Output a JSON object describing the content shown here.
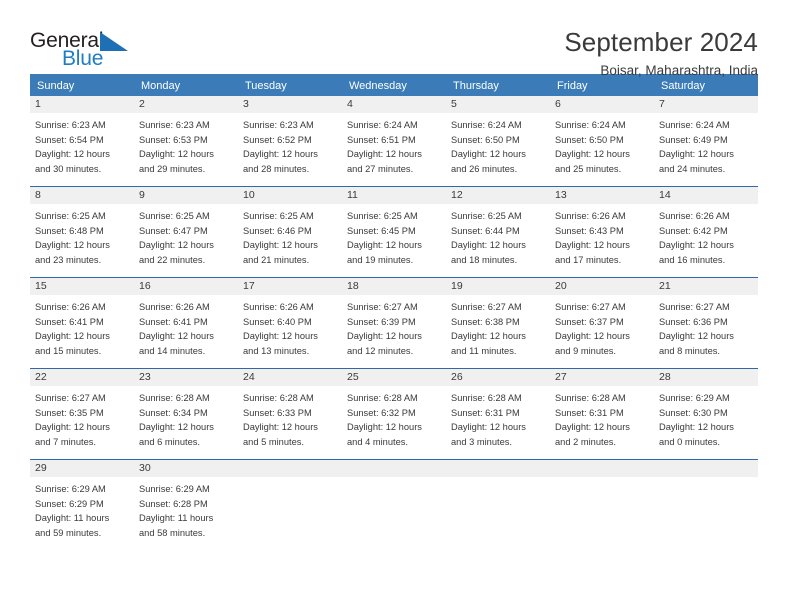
{
  "brand": {
    "name_part1": "General",
    "name_part2": "Blue",
    "logo_icon": "triangle-mark-icon",
    "accent_color": "#1f7dc4"
  },
  "header": {
    "title": "September 2024",
    "subtitle": "Boisar, Maharashtra, India"
  },
  "calendar": {
    "header_color": "#3b7cb8",
    "daynum_band_color": "#f0f0f0",
    "weekdays": [
      "Sunday",
      "Monday",
      "Tuesday",
      "Wednesday",
      "Thursday",
      "Friday",
      "Saturday"
    ],
    "weeks": [
      [
        {
          "day": "1",
          "sunrise": "Sunrise: 6:23 AM",
          "sunset": "Sunset: 6:54 PM",
          "daylight_line1": "Daylight: 12 hours",
          "daylight_line2": "and 30 minutes."
        },
        {
          "day": "2",
          "sunrise": "Sunrise: 6:23 AM",
          "sunset": "Sunset: 6:53 PM",
          "daylight_line1": "Daylight: 12 hours",
          "daylight_line2": "and 29 minutes."
        },
        {
          "day": "3",
          "sunrise": "Sunrise: 6:23 AM",
          "sunset": "Sunset: 6:52 PM",
          "daylight_line1": "Daylight: 12 hours",
          "daylight_line2": "and 28 minutes."
        },
        {
          "day": "4",
          "sunrise": "Sunrise: 6:24 AM",
          "sunset": "Sunset: 6:51 PM",
          "daylight_line1": "Daylight: 12 hours",
          "daylight_line2": "and 27 minutes."
        },
        {
          "day": "5",
          "sunrise": "Sunrise: 6:24 AM",
          "sunset": "Sunset: 6:50 PM",
          "daylight_line1": "Daylight: 12 hours",
          "daylight_line2": "and 26 minutes."
        },
        {
          "day": "6",
          "sunrise": "Sunrise: 6:24 AM",
          "sunset": "Sunset: 6:50 PM",
          "daylight_line1": "Daylight: 12 hours",
          "daylight_line2": "and 25 minutes."
        },
        {
          "day": "7",
          "sunrise": "Sunrise: 6:24 AM",
          "sunset": "Sunset: 6:49 PM",
          "daylight_line1": "Daylight: 12 hours",
          "daylight_line2": "and 24 minutes."
        }
      ],
      [
        {
          "day": "8",
          "sunrise": "Sunrise: 6:25 AM",
          "sunset": "Sunset: 6:48 PM",
          "daylight_line1": "Daylight: 12 hours",
          "daylight_line2": "and 23 minutes."
        },
        {
          "day": "9",
          "sunrise": "Sunrise: 6:25 AM",
          "sunset": "Sunset: 6:47 PM",
          "daylight_line1": "Daylight: 12 hours",
          "daylight_line2": "and 22 minutes."
        },
        {
          "day": "10",
          "sunrise": "Sunrise: 6:25 AM",
          "sunset": "Sunset: 6:46 PM",
          "daylight_line1": "Daylight: 12 hours",
          "daylight_line2": "and 21 minutes."
        },
        {
          "day": "11",
          "sunrise": "Sunrise: 6:25 AM",
          "sunset": "Sunset: 6:45 PM",
          "daylight_line1": "Daylight: 12 hours",
          "daylight_line2": "and 19 minutes."
        },
        {
          "day": "12",
          "sunrise": "Sunrise: 6:25 AM",
          "sunset": "Sunset: 6:44 PM",
          "daylight_line1": "Daylight: 12 hours",
          "daylight_line2": "and 18 minutes."
        },
        {
          "day": "13",
          "sunrise": "Sunrise: 6:26 AM",
          "sunset": "Sunset: 6:43 PM",
          "daylight_line1": "Daylight: 12 hours",
          "daylight_line2": "and 17 minutes."
        },
        {
          "day": "14",
          "sunrise": "Sunrise: 6:26 AM",
          "sunset": "Sunset: 6:42 PM",
          "daylight_line1": "Daylight: 12 hours",
          "daylight_line2": "and 16 minutes."
        }
      ],
      [
        {
          "day": "15",
          "sunrise": "Sunrise: 6:26 AM",
          "sunset": "Sunset: 6:41 PM",
          "daylight_line1": "Daylight: 12 hours",
          "daylight_line2": "and 15 minutes."
        },
        {
          "day": "16",
          "sunrise": "Sunrise: 6:26 AM",
          "sunset": "Sunset: 6:41 PM",
          "daylight_line1": "Daylight: 12 hours",
          "daylight_line2": "and 14 minutes."
        },
        {
          "day": "17",
          "sunrise": "Sunrise: 6:26 AM",
          "sunset": "Sunset: 6:40 PM",
          "daylight_line1": "Daylight: 12 hours",
          "daylight_line2": "and 13 minutes."
        },
        {
          "day": "18",
          "sunrise": "Sunrise: 6:27 AM",
          "sunset": "Sunset: 6:39 PM",
          "daylight_line1": "Daylight: 12 hours",
          "daylight_line2": "and 12 minutes."
        },
        {
          "day": "19",
          "sunrise": "Sunrise: 6:27 AM",
          "sunset": "Sunset: 6:38 PM",
          "daylight_line1": "Daylight: 12 hours",
          "daylight_line2": "and 11 minutes."
        },
        {
          "day": "20",
          "sunrise": "Sunrise: 6:27 AM",
          "sunset": "Sunset: 6:37 PM",
          "daylight_line1": "Daylight: 12 hours",
          "daylight_line2": "and 9 minutes."
        },
        {
          "day": "21",
          "sunrise": "Sunrise: 6:27 AM",
          "sunset": "Sunset: 6:36 PM",
          "daylight_line1": "Daylight: 12 hours",
          "daylight_line2": "and 8 minutes."
        }
      ],
      [
        {
          "day": "22",
          "sunrise": "Sunrise: 6:27 AM",
          "sunset": "Sunset: 6:35 PM",
          "daylight_line1": "Daylight: 12 hours",
          "daylight_line2": "and 7 minutes."
        },
        {
          "day": "23",
          "sunrise": "Sunrise: 6:28 AM",
          "sunset": "Sunset: 6:34 PM",
          "daylight_line1": "Daylight: 12 hours",
          "daylight_line2": "and 6 minutes."
        },
        {
          "day": "24",
          "sunrise": "Sunrise: 6:28 AM",
          "sunset": "Sunset: 6:33 PM",
          "daylight_line1": "Daylight: 12 hours",
          "daylight_line2": "and 5 minutes."
        },
        {
          "day": "25",
          "sunrise": "Sunrise: 6:28 AM",
          "sunset": "Sunset: 6:32 PM",
          "daylight_line1": "Daylight: 12 hours",
          "daylight_line2": "and 4 minutes."
        },
        {
          "day": "26",
          "sunrise": "Sunrise: 6:28 AM",
          "sunset": "Sunset: 6:31 PM",
          "daylight_line1": "Daylight: 12 hours",
          "daylight_line2": "and 3 minutes."
        },
        {
          "day": "27",
          "sunrise": "Sunrise: 6:28 AM",
          "sunset": "Sunset: 6:31 PM",
          "daylight_line1": "Daylight: 12 hours",
          "daylight_line2": "and 2 minutes."
        },
        {
          "day": "28",
          "sunrise": "Sunrise: 6:29 AM",
          "sunset": "Sunset: 6:30 PM",
          "daylight_line1": "Daylight: 12 hours",
          "daylight_line2": "and 0 minutes."
        }
      ],
      [
        {
          "day": "29",
          "sunrise": "Sunrise: 6:29 AM",
          "sunset": "Sunset: 6:29 PM",
          "daylight_line1": "Daylight: 11 hours",
          "daylight_line2": "and 59 minutes."
        },
        {
          "day": "30",
          "sunrise": "Sunrise: 6:29 AM",
          "sunset": "Sunset: 6:28 PM",
          "daylight_line1": "Daylight: 11 hours",
          "daylight_line2": "and 58 minutes."
        },
        {
          "day": "",
          "sunrise": "",
          "sunset": "",
          "daylight_line1": "",
          "daylight_line2": ""
        },
        {
          "day": "",
          "sunrise": "",
          "sunset": "",
          "daylight_line1": "",
          "daylight_line2": ""
        },
        {
          "day": "",
          "sunrise": "",
          "sunset": "",
          "daylight_line1": "",
          "daylight_line2": ""
        },
        {
          "day": "",
          "sunrise": "",
          "sunset": "",
          "daylight_line1": "",
          "daylight_line2": ""
        },
        {
          "day": "",
          "sunrise": "",
          "sunset": "",
          "daylight_line1": "",
          "daylight_line2": ""
        }
      ]
    ]
  }
}
